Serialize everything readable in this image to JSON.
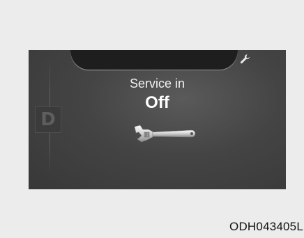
{
  "display": {
    "gear_indicator": "D",
    "service_title": "Service in",
    "service_value": "Off",
    "top_icon": "wrench-icon",
    "center_icon": "adjustable-wrench-icon"
  },
  "figure_code": "ODH043405L",
  "colors": {
    "page_background": "#ececec",
    "screen_background": "#444444",
    "top_tab": "#1e1e1e",
    "text": "#ffffff"
  }
}
